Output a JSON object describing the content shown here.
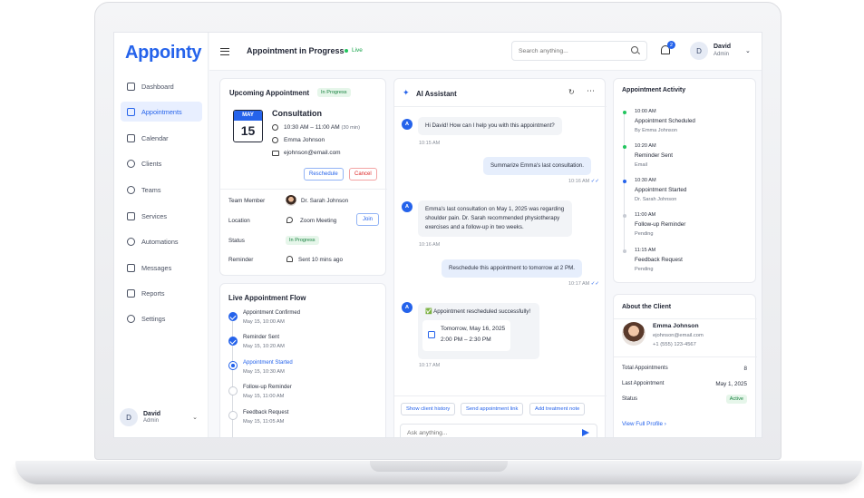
{
  "brand": {
    "logo_text": "Appointy",
    "accent": "#2563eb"
  },
  "sidebar": {
    "items": [
      {
        "label": "Dashboard",
        "icon": "dashboard-icon",
        "active": false
      },
      {
        "label": "Appointments",
        "icon": "calendar-check-icon",
        "active": true
      },
      {
        "label": "Calendar",
        "icon": "calendar-icon",
        "active": false
      },
      {
        "label": "Clients",
        "icon": "users-icon",
        "active": false
      },
      {
        "label": "Teams",
        "icon": "team-icon",
        "active": false
      },
      {
        "label": "Services",
        "icon": "clipboard-icon",
        "active": false
      },
      {
        "label": "Automations",
        "icon": "bell-icon",
        "active": false
      },
      {
        "label": "Messages",
        "icon": "message-icon",
        "active": false
      },
      {
        "label": "Reports",
        "icon": "chart-icon",
        "active": false
      },
      {
        "label": "Settings",
        "icon": "gear-icon",
        "active": false
      }
    ],
    "user": {
      "initial": "D",
      "name": "David",
      "role": "Admin"
    }
  },
  "header": {
    "title": "Appointment in Progress",
    "live_label": "Live",
    "search_placeholder": "Search anything...",
    "notification_count": "2",
    "user": {
      "initial": "D",
      "name": "David",
      "role": "Admin"
    }
  },
  "upcoming": {
    "title": "Upcoming Appointment",
    "status_badge": "In Progress",
    "month": "MAY",
    "day": "15",
    "name": "Consultation",
    "time": "10:30 AM – 11:00 AM",
    "duration": "(30 min)",
    "client": "Emma Johnson",
    "email": "ejohnson@email.com",
    "reschedule_label": "Reschedule",
    "cancel_label": "Cancel",
    "rows": {
      "team_member_label": "Team Member",
      "team_member": "Dr. Sarah Johnson",
      "location_label": "Location",
      "location": "Zoom Meeting",
      "join_label": "Join",
      "status_label": "Status",
      "status": "In Progress",
      "reminder_label": "Reminder",
      "reminder": "Sent 10 mins ago"
    }
  },
  "flow": {
    "title": "Live Appointment Flow",
    "steps": [
      {
        "label": "Appointment Confirmed",
        "time": "May 15, 10:00 AM",
        "state": "done"
      },
      {
        "label": "Reminder Sent",
        "time": "May 15, 10:20 AM",
        "state": "done"
      },
      {
        "label": "Appointment Started",
        "time": "May 15, 10:30 AM",
        "state": "active"
      },
      {
        "label": "Follow-up Reminder",
        "time": "May 15, 11:00 AM",
        "state": "pending"
      },
      {
        "label": "Feedback Request",
        "time": "May 15, 11:05 AM",
        "state": "pending"
      }
    ]
  },
  "assistant": {
    "title": "AI Assistant",
    "bot_initial": "A",
    "messages": [
      {
        "from": "bot",
        "text": "Hi David! How can I help you with this appointment?",
        "time": "10:15 AM"
      },
      {
        "from": "user",
        "text": "Summarize Emma's last consultation.",
        "time": "10:16 AM"
      },
      {
        "from": "bot",
        "lines": [
          "Emma's last consultation on May 1, 2025 was regarding",
          "shoulder pain. Dr. Sarah recommended physiotherapy",
          "exercises and a follow-up in two weeks."
        ],
        "time": "10:16 AM"
      },
      {
        "from": "user",
        "text": "Reschedule this appointment to tomorrow at 2 PM.",
        "time": "10:17 AM"
      },
      {
        "from": "bot",
        "text": "✅ Appointment rescheduled successfully!",
        "card_date": "Tomorrow, May 16, 2025",
        "card_time": "2:00 PM – 2:30 PM",
        "time": "10:17 AM"
      }
    ],
    "chips": [
      "Show client history",
      "Send appointment link",
      "Add treatment note"
    ],
    "input_placeholder": "Ask anything..."
  },
  "activity": {
    "title": "Appointment Activity",
    "items": [
      {
        "time": "10:00 AM",
        "title": "Appointment Scheduled",
        "sub": "By Emma Johnson",
        "color": "#22c55e"
      },
      {
        "time": "10:20 AM",
        "title": "Reminder Sent",
        "sub": "Email",
        "color": "#22c55e"
      },
      {
        "time": "10:30 AM",
        "title": "Appointment Started",
        "sub": "Dr. Sarah Johnson",
        "color": "#2563eb"
      },
      {
        "time": "11:00 AM",
        "title": "Follow-up Reminder",
        "sub": "Pending",
        "color": "#c7cbd3"
      },
      {
        "time": "11:15 AM",
        "title": "Feedback Request",
        "sub": "Pending",
        "color": "#c7cbd3"
      }
    ]
  },
  "client": {
    "title": "About the Client",
    "name": "Emma Johnson",
    "email": "ejohnson@email.com",
    "phone": "+1 (555) 123-4567",
    "stats": [
      {
        "label": "Total Appointments",
        "value": "8"
      },
      {
        "label": "Last Appointment",
        "value": "May 1, 2025"
      },
      {
        "label": "Status",
        "value": "Active"
      }
    ],
    "view_profile": "View Full Profile"
  }
}
